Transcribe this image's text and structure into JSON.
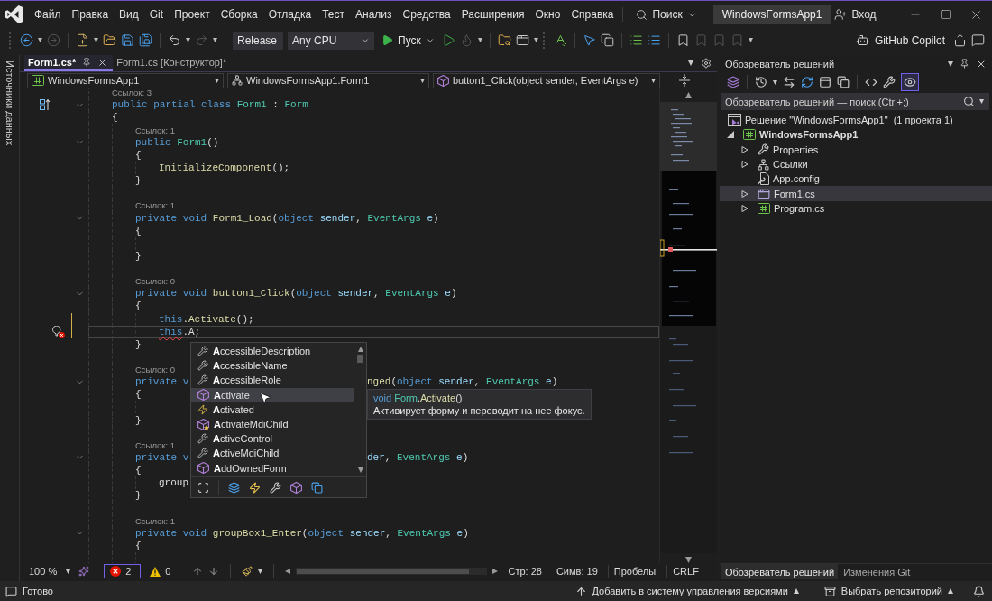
{
  "window": {
    "menu": [
      "Файл",
      "Правка",
      "Вид",
      "Git",
      "Проект",
      "Сборка",
      "Отладка",
      "Тест",
      "Анализ",
      "Средства",
      "Расширения",
      "Окно",
      "Справка"
    ],
    "search": "Поиск",
    "solution_name": "WindowsFormsApp1",
    "sign_in": "Вход"
  },
  "toolbar": {
    "configuration": "Release",
    "platform": "Any CPU",
    "run": "Пуск",
    "copilot": "GitHub Copilot"
  },
  "side_strip": {
    "tab": "Источники данных"
  },
  "editor": {
    "tabs": [
      {
        "label": "Form1.cs*",
        "selected": true
      },
      {
        "label": "Form1.cs [Конструктор]*",
        "selected": false
      }
    ],
    "nav": [
      "WindowsFormsApp1",
      "WindowsFormsApp1.Form1",
      "button1_Click(object sender, EventArgs e)"
    ],
    "code": [
      {
        "kind": "lens",
        "text": "Ссылок: 3"
      },
      {
        "kind": "header",
        "glyph": {
          "kind": "inherits"
        },
        "expanded": true,
        "changed": false,
        "current": false,
        "tokens": [
          {
            "kind": "keyword",
            "text": "public partial class "
          },
          {
            "kind": "type",
            "text": "Form1"
          },
          {
            "kind": "plain",
            "text": " : "
          },
          {
            "kind": "type",
            "text": "Form"
          }
        ]
      },
      {
        "kind": "line",
        "changed": false,
        "current": false,
        "tokens": [
          {
            "kind": "plain",
            "text": "{"
          }
        ]
      },
      {
        "kind": "block",
        "children": [
          {
            "kind": "lens",
            "text": "Ссылок: 1"
          },
          {
            "kind": "header",
            "expanded": true,
            "changed": false,
            "current": false,
            "tokens": [
              {
                "kind": "keyword",
                "text": "public "
              },
              {
                "kind": "type",
                "text": "Form1"
              },
              {
                "kind": "plain",
                "text": "()"
              }
            ]
          },
          {
            "kind": "line",
            "changed": false,
            "current": false,
            "tokens": [
              {
                "kind": "plain",
                "text": "{"
              }
            ]
          },
          {
            "kind": "block",
            "children": [
              {
                "kind": "line",
                "changed": false,
                "current": false,
                "tokens": [
                  {
                    "kind": "method",
                    "text": "InitializeComponent"
                  },
                  {
                    "kind": "plain",
                    "text": "();"
                  }
                ]
              }
            ]
          },
          {
            "kind": "line",
            "changed": false,
            "current": false,
            "tokens": [
              {
                "kind": "plain",
                "text": "}"
              }
            ]
          },
          {
            "kind": "blank"
          },
          {
            "kind": "lens",
            "text": "Ссылок: 1"
          },
          {
            "kind": "header",
            "expanded": true,
            "changed": false,
            "current": false,
            "tokens": [
              {
                "kind": "keyword",
                "text": "private void "
              },
              {
                "kind": "method",
                "text": "Form1_Load"
              },
              {
                "kind": "plain",
                "text": "("
              },
              {
                "kind": "keyword",
                "text": "object "
              },
              {
                "kind": "param",
                "text": "sender"
              },
              {
                "kind": "plain",
                "text": ", "
              },
              {
                "kind": "type",
                "text": "EventArgs "
              },
              {
                "kind": "param",
                "text": "e"
              },
              {
                "kind": "plain",
                "text": ")"
              }
            ]
          },
          {
            "kind": "line",
            "changed": false,
            "current": false,
            "tokens": [
              {
                "kind": "plain",
                "text": "{"
              }
            ]
          },
          {
            "kind": "block",
            "children": [
              {
                "kind": "blank"
              }
            ]
          },
          {
            "kind": "line",
            "changed": false,
            "current": false,
            "tokens": [
              {
                "kind": "plain",
                "text": "}"
              }
            ]
          },
          {
            "kind": "blank"
          },
          {
            "kind": "lens",
            "text": "Ссылок: 0"
          },
          {
            "kind": "header",
            "expanded": true,
            "changed": false,
            "current": false,
            "tokens": [
              {
                "kind": "keyword",
                "text": "private void "
              },
              {
                "kind": "method",
                "text": "button1_Click"
              },
              {
                "kind": "plain",
                "text": "("
              },
              {
                "kind": "keyword",
                "text": "object "
              },
              {
                "kind": "param",
                "text": "sender"
              },
              {
                "kind": "plain",
                "text": ", "
              },
              {
                "kind": "type",
                "text": "EventArgs "
              },
              {
                "kind": "param",
                "text": "e"
              },
              {
                "kind": "plain",
                "text": ")"
              }
            ]
          },
          {
            "kind": "line",
            "changed": false,
            "current": false,
            "tokens": [
              {
                "kind": "plain",
                "text": "{"
              }
            ]
          },
          {
            "kind": "block",
            "children": [
              {
                "kind": "line",
                "changed": true,
                "current": false,
                "tokens": [
                  {
                    "kind": "keyword",
                    "text": "this"
                  },
                  {
                    "kind": "plain",
                    "text": "."
                  },
                  {
                    "kind": "method",
                    "text": "Activate"
                  },
                  {
                    "kind": "plain",
                    "text": "();"
                  }
                ]
              },
              {
                "kind": "line",
                "glyph": {
                  "kind": "quick-action"
                },
                "changed": true,
                "current": true,
                "tokens": [
                  {
                    "kind": "error",
                    "text": "this"
                  },
                  {
                    "kind": "plain",
                    "text": ".A;"
                  }
                ]
              }
            ]
          },
          {
            "kind": "line",
            "changed": false,
            "current": false,
            "tokens": [
              {
                "kind": "plain",
                "text": "}"
              }
            ]
          },
          {
            "kind": "blank"
          },
          {
            "kind": "lens",
            "text": "Ссылок: 0"
          },
          {
            "kind": "header",
            "expanded": true,
            "changed": false,
            "current": false,
            "tokens": [
              {
                "kind": "keyword",
                "text": "private v"
              }
            ],
            "after_popup": [
              {
                "kind": "method",
                "text": "nged"
              },
              {
                "kind": "plain",
                "text": "("
              },
              {
                "kind": "keyword",
                "text": "object "
              },
              {
                "kind": "param",
                "text": "sender"
              },
              {
                "kind": "plain",
                "text": ", "
              },
              {
                "kind": "type",
                "text": "EventArgs "
              },
              {
                "kind": "param",
                "text": "e"
              },
              {
                "kind": "plain",
                "text": ")"
              }
            ]
          },
          {
            "kind": "line",
            "changed": false,
            "current": false,
            "tokens": [
              {
                "kind": "plain",
                "text": "{"
              }
            ]
          },
          {
            "kind": "block",
            "children": [
              {
                "kind": "blank"
              }
            ]
          },
          {
            "kind": "line",
            "changed": false,
            "current": false,
            "tokens": [
              {
                "kind": "plain",
                "text": "}"
              }
            ]
          },
          {
            "kind": "blank"
          },
          {
            "kind": "lens",
            "text": "Ссылок: 1"
          },
          {
            "kind": "header",
            "expanded": true,
            "changed": false,
            "current": false,
            "tokens": [
              {
                "kind": "keyword",
                "text": "private v"
              }
            ],
            "after_popup": [
              {
                "kind": "param",
                "text": "der"
              },
              {
                "kind": "plain",
                "text": ", "
              },
              {
                "kind": "type",
                "text": "EventArgs "
              },
              {
                "kind": "param",
                "text": "e"
              },
              {
                "kind": "plain",
                "text": ")"
              }
            ]
          },
          {
            "kind": "line",
            "changed": false,
            "current": false,
            "tokens": [
              {
                "kind": "plain",
                "text": "{"
              }
            ]
          },
          {
            "kind": "block",
            "children": [
              {
                "kind": "line",
                "changed": false,
                "current": false,
                "tokens": [
                  {
                    "kind": "plain",
                    "text": "group"
                  }
                ]
              }
            ]
          },
          {
            "kind": "line",
            "changed": false,
            "current": false,
            "tokens": [
              {
                "kind": "plain",
                "text": "}"
              }
            ]
          },
          {
            "kind": "blank"
          },
          {
            "kind": "lens",
            "text": "Ссылок: 1"
          },
          {
            "kind": "header",
            "expanded": true,
            "changed": false,
            "current": false,
            "tokens": [
              {
                "kind": "keyword",
                "text": "private void "
              },
              {
                "kind": "method",
                "text": "groupBox1_Enter"
              },
              {
                "kind": "plain",
                "text": "("
              },
              {
                "kind": "keyword",
                "text": "object "
              },
              {
                "kind": "param",
                "text": "sender"
              },
              {
                "kind": "plain",
                "text": ", "
              },
              {
                "kind": "type",
                "text": "EventArgs "
              },
              {
                "kind": "param",
                "text": "e"
              },
              {
                "kind": "plain",
                "text": ")"
              }
            ]
          },
          {
            "kind": "line",
            "changed": false,
            "current": false,
            "tokens": [
              {
                "kind": "plain",
                "text": "{"
              }
            ]
          },
          {
            "kind": "block",
            "children": [
              {
                "kind": "blank"
              }
            ]
          }
        ]
      }
    ],
    "completion": {
      "items": [
        {
          "text": "**A**ccessibleDescription",
          "kind": "property",
          "selected": false
        },
        {
          "text": "**A**ccessibleName",
          "kind": "property",
          "selected": false
        },
        {
          "text": "**A**ccessibleRole",
          "kind": "property",
          "selected": false
        },
        {
          "text": "**A**ctivate",
          "kind": "method",
          "selected": true
        },
        {
          "text": "**A**ctivated",
          "kind": "event",
          "selected": false
        },
        {
          "text": "**A**ctivateMdiChild",
          "kind": "protected",
          "selected": false
        },
        {
          "text": "**A**ctiveControl",
          "kind": "property",
          "selected": false
        },
        {
          "text": "**A**ctiveMdiChild",
          "kind": "property",
          "selected": false
        },
        {
          "text": "**A**ddOwnedForm",
          "kind": "method",
          "selected": false
        }
      ]
    },
    "quick_info": {
      "signature": [
        {
          "kind": "keyword",
          "text": "void "
        },
        {
          "kind": "type",
          "text": "Form"
        },
        {
          "kind": "plain",
          "text": "."
        },
        {
          "kind": "method",
          "text": "Activate"
        },
        {
          "kind": "plain",
          "text": "()"
        }
      ],
      "description": "Активирует форму и переводит на нее фокус."
    },
    "status": {
      "zoom": "100 %",
      "errors": "2",
      "warnings": "0",
      "line": "Стр: 28",
      "column": "Симв: 19",
      "indent": "Пробелы",
      "line_ending": "CRLF"
    }
  },
  "solution_explorer": {
    "title": "Обозреватель решений",
    "preview_toggle": {
      "on": true
    },
    "search": {
      "placeholder": "Обозреватель решений — поиск (Ctrl+;)"
    },
    "tree": [
      {
        "label": "Решение \"WindowsFormsApp1\"  (1 проекта 1)",
        "kind": "solution",
        "selected": false,
        "children": [
          {
            "label": "WindowsFormsApp1",
            "kind": "project",
            "expanded": true,
            "selected": false,
            "children": [
              {
                "label": "Properties",
                "kind": "properties",
                "expanded": false,
                "selected": false
              },
              {
                "label": "Ссылки",
                "kind": "references",
                "expanded": false,
                "selected": false
              },
              {
                "label": "App.config",
                "kind": "config",
                "selected": false
              },
              {
                "label": "Form1.cs",
                "kind": "form",
                "expanded": false,
                "selected": true
              },
              {
                "label": "Program.cs",
                "kind": "csharp",
                "expanded": false,
                "selected": false
              }
            ]
          }
        ]
      }
    ],
    "bottom_tabs": [
      {
        "label": "Обозреватель решений",
        "selected": true
      },
      {
        "label": "Изменения Git",
        "selected": false
      }
    ]
  },
  "status_bar": {
    "message": "Готово",
    "source_control": "Добавить в систему управления версиями",
    "repository": "Выбрать репозиторий"
  }
}
